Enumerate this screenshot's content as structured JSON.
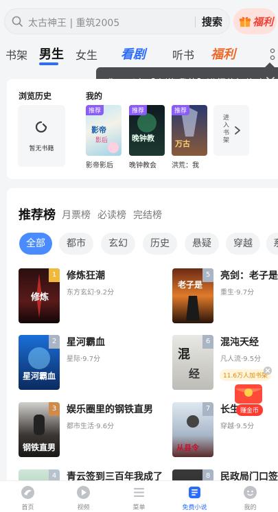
{
  "search": {
    "placeholder": "太古神王 | 重筑2005",
    "button": "搜索",
    "fuli": "福利"
  },
  "tabs": [
    {
      "label": "书架"
    },
    {
      "label": "男生",
      "active": true
    },
    {
      "label": "女生"
    },
    {
      "label": "看剧"
    },
    {
      "label": "听书"
    },
    {
      "label": "福利"
    }
  ],
  "tooltip": {
    "text": "你可以在【小说-我的】进行偏好修改"
  },
  "history": {
    "title": "浏览历史",
    "shelf_title": "我的",
    "empty_text": "暂无书籍",
    "books": [
      {
        "title": "影帝影后",
        "tag": "推荐"
      },
      {
        "title": "晚钟教会",
        "tag": "推荐"
      },
      {
        "title": "洪荒：我",
        "tag": "推荐"
      }
    ],
    "enter_shelf": "进入书架"
  },
  "ranking": {
    "title": "推荐榜",
    "subtabs": [
      "月票榜",
      "必读榜",
      "完结榜"
    ],
    "chips": [
      "全部",
      "都市",
      "玄幻",
      "历史",
      "悬疑",
      "穿越",
      "系"
    ],
    "books_left": [
      {
        "rank": "1",
        "title": "修炼狂潮",
        "meta": "东方玄幻·9.2分"
      },
      {
        "rank": "2",
        "title": "星河霸血",
        "meta": "星际·9.7分"
      },
      {
        "rank": "3",
        "title": "娱乐圈里的钢铁直男",
        "meta": "都市生活·9.6分"
      },
      {
        "rank": "4",
        "title": "青云签到三百年我成了"
      }
    ],
    "books_right": [
      {
        "rank": "5",
        "title": "亮剑：老子是丁",
        "meta": "重生·9.7分"
      },
      {
        "rank": "6",
        "title": "混沌天经",
        "meta": "凡人流·9.5分"
      },
      {
        "rank": "7",
        "title": "长生",
        "meta": "穿越·9.5分"
      },
      {
        "rank": "8",
        "title": "民政局门口签到"
      }
    ]
  },
  "floating": {
    "banner": "11.6万人加书架",
    "pill": "赚金币"
  },
  "nav": [
    {
      "label": "首页",
      "icon": "home-icon"
    },
    {
      "label": "视频",
      "icon": "video-icon"
    },
    {
      "label": "菜单",
      "icon": "menu-icon"
    },
    {
      "label": "免费小说",
      "icon": "book-icon",
      "active": true
    },
    {
      "label": "我的",
      "icon": "profile-icon"
    }
  ],
  "colors": {
    "accent": "#2b6cff",
    "fuli": "#ef4236",
    "chip_active": "#4a8cff",
    "tag": "#8b5cf6"
  }
}
